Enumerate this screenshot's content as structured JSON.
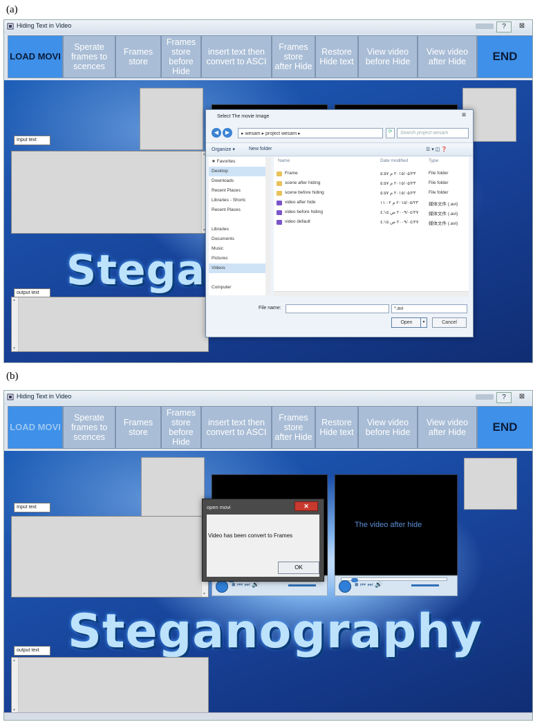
{
  "panels": [
    {
      "label": "(a)",
      "window": {
        "title": "Hiding Text in Video",
        "help_label": "?",
        "close_label": "⊠",
        "toolbar": [
          "LOAD MOVI",
          "Sperate\nframes to\nscences",
          "Frames\nstore",
          "Frames\nstore\nbefore\nHide",
          "insert text then\nconvert to ASCI",
          "Frames\nstore\nafter Hide",
          "Restore\nHide text",
          "View video\nbefore Hide",
          "View video\nafter Hide",
          "END"
        ],
        "input_label": "Input text",
        "output_label": "output text",
        "banner": "Stega"
      },
      "file_dialog": {
        "title": "Select The movie Image",
        "close": "⊠",
        "path": "▸ wesam ▸ project wesam ▸",
        "search_placeholder": "Search project wesam",
        "organize": "Organize ▾",
        "new_folder": "New folder",
        "views": "☰ ▾  ◫  ❓",
        "tree": [
          {
            "label": "★ Favorites"
          },
          {
            "label": "Desktop",
            "selected": true
          },
          {
            "label": "Downloads"
          },
          {
            "label": "Recent Places"
          },
          {
            "label": "Libraries - Shortc"
          },
          {
            "label": "Recent Places"
          },
          {
            "label": ""
          },
          {
            "label": "Libraries"
          },
          {
            "label": "Documents"
          },
          {
            "label": "Music"
          },
          {
            "label": "Pictures"
          },
          {
            "label": "Videos",
            "selected": true
          },
          {
            "label": ""
          },
          {
            "label": "Computer"
          }
        ],
        "columns": {
          "name": "Name",
          "date": "Date modified",
          "type": "Type"
        },
        "files": [
          {
            "name": "Frame",
            "date": "٢٠١٥/٠٥/٢٣ م ٥:٥٧",
            "type": "File folder",
            "icon": "folder"
          },
          {
            "name": "scene after hiding",
            "date": "٢٠١٥/٠٥/٢٣ م ٥:٥٧",
            "type": "File folder",
            "icon": "folder"
          },
          {
            "name": "scene before hiding",
            "date": "٢٠١٥/٠٥/٢٣ م ٥:٥٧",
            "type": "File folder",
            "icon": "folder"
          },
          {
            "name": "video after hide",
            "date": "٢٠١٥/٠٥/٢٣ م ١١:٠٢",
            "type": "媒体文件 (.avi)",
            "icon": "media"
          },
          {
            "name": "video before hiding",
            "date": "٢٠٠٩/٠٤/٢٧ ص ٤:١٥",
            "type": "媒体文件 (.avi)",
            "icon": "media"
          },
          {
            "name": "video default",
            "date": "٢٠٠٩/٠٤/٢٧ ص ٤:١٥",
            "type": "媒体文件 (.avi)",
            "icon": "media"
          }
        ],
        "filename_label": "File name:",
        "filter": "*.avi",
        "open": "Open",
        "cancel": "Cancel"
      }
    },
    {
      "label": "(b)",
      "window": {
        "title": "Hiding Text in Video",
        "help_label": "?",
        "close_label": "⊠",
        "toolbar": [
          "LOAD MOVI",
          "Sperate\nframes to\nscences",
          "Frames\nstore",
          "Frames\nstore\nbefore\nHide",
          "insert text then\nconvert to ASCI",
          "Frames\nstore\nafter Hide",
          "Restore\nHide text",
          "View video\nbefore Hide",
          "View video\nafter Hide",
          "END"
        ],
        "input_label": "Input text",
        "output_label": "output text",
        "banner": "Steganography",
        "video_after_caption": "The video after hide"
      },
      "message_box": {
        "title": "open movi",
        "close": "✕",
        "text": "Video has been convert to Frames",
        "ok": "OK"
      }
    }
  ],
  "colors": {
    "button_blue": "#3e90e8",
    "button_grey_blue": "#a9bdd6",
    "background_blue": "#1a4da6",
    "panel_grey": "#d8d8d8"
  }
}
